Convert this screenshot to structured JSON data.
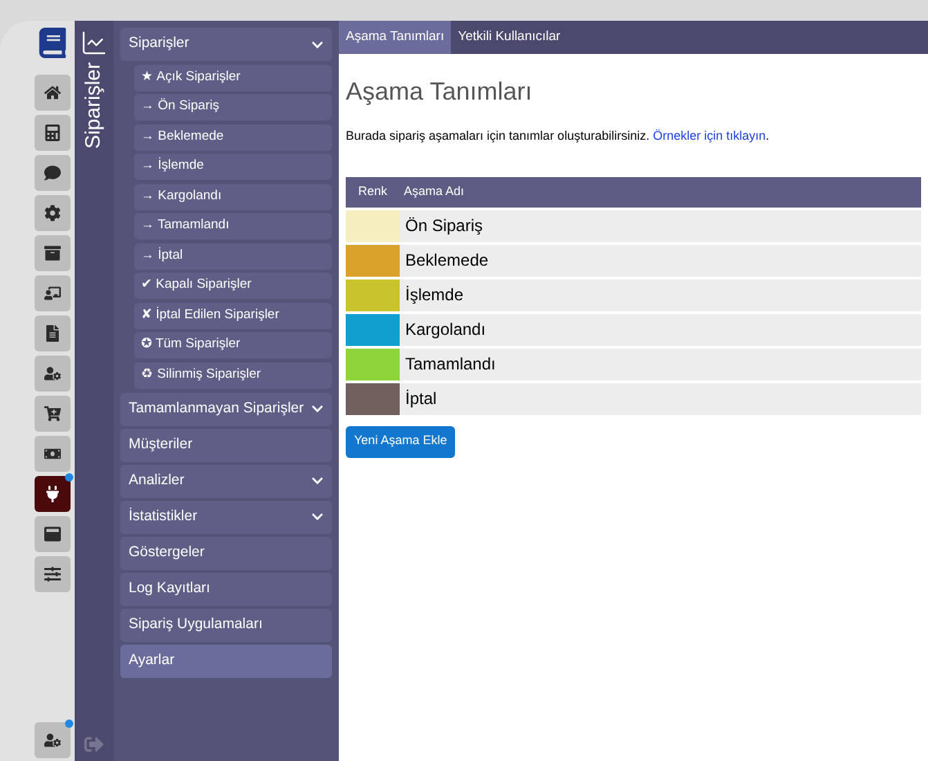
{
  "rail": {
    "buttons": [
      {
        "selected": false,
        "badge": false
      },
      {
        "selected": false,
        "badge": false
      },
      {
        "selected": false,
        "badge": false
      },
      {
        "selected": false,
        "badge": false
      },
      {
        "selected": false,
        "badge": false
      },
      {
        "selected": false,
        "badge": false
      },
      {
        "selected": false,
        "badge": false
      },
      {
        "selected": false,
        "badge": false
      },
      {
        "selected": false,
        "badge": false
      },
      {
        "selected": false,
        "badge": false
      },
      {
        "selected": true,
        "badge": true
      },
      {
        "selected": false,
        "badge": false
      },
      {
        "selected": false,
        "badge": false
      }
    ],
    "bottom_button": {
      "badge": true
    }
  },
  "section_title": "Siparişler",
  "menu": [
    {
      "label": "Siparişler",
      "expandable": true,
      "expanded": true,
      "selected": false,
      "children": [
        {
          "label": "★ Açık Siparişler"
        },
        {
          "label": "→ Ön Sipariş"
        },
        {
          "label": "→ Beklemede"
        },
        {
          "label": "→ İşlemde"
        },
        {
          "label": "→ Kargolandı"
        },
        {
          "label": "→ Tamamlandı"
        },
        {
          "label": "→ İptal"
        },
        {
          "label": "✔ Kapalı Siparişler"
        },
        {
          "label": "✘ İptal Edilen Siparişler"
        },
        {
          "label": "✪ Tüm Siparişler"
        },
        {
          "label": "♻ Silinmiş Siparişler"
        }
      ]
    },
    {
      "label": "Tamamlanmayan Siparişler",
      "expandable": true,
      "expanded": false,
      "selected": false
    },
    {
      "label": "Müşteriler",
      "expandable": false,
      "selected": false
    },
    {
      "label": "Analizler",
      "expandable": true,
      "expanded": false,
      "selected": false
    },
    {
      "label": "İstatistikler",
      "expandable": true,
      "expanded": false,
      "selected": false
    },
    {
      "label": "Göstergeler",
      "expandable": false,
      "selected": false
    },
    {
      "label": "Log Kayıtları",
      "expandable": false,
      "selected": false
    },
    {
      "label": "Sipariş Uygulamaları",
      "expandable": false,
      "selected": false
    },
    {
      "label": "Ayarlar",
      "expandable": false,
      "selected": true
    }
  ],
  "tabs": [
    {
      "label": "Aşama Tanımları",
      "selected": true
    },
    {
      "label": "Yetkili Kullanıcılar",
      "selected": false
    }
  ],
  "title": "Aşama Tanımları",
  "intro": {
    "text": "Burada sipariş aşamaları için tanımlar oluşturabilirsiniz.",
    "link": "Örnekler için tıklayın",
    "end": "."
  },
  "table": {
    "columns": [
      "Renk",
      "Aşama Adı"
    ],
    "rows": [
      {
        "color": "#f5efc0",
        "name": "Ön Sipariş"
      },
      {
        "color": "#d9a32b",
        "name": "Beklemede"
      },
      {
        "color": "#c9c42e",
        "name": "İşlemde"
      },
      {
        "color": "#119fd0",
        "name": "Kargolandı"
      },
      {
        "color": "#8fd43a",
        "name": "Tamamlandı"
      },
      {
        "color": "#72605e",
        "name": "İptal"
      }
    ]
  },
  "add_button": "Yeni Aşama Ekle"
}
